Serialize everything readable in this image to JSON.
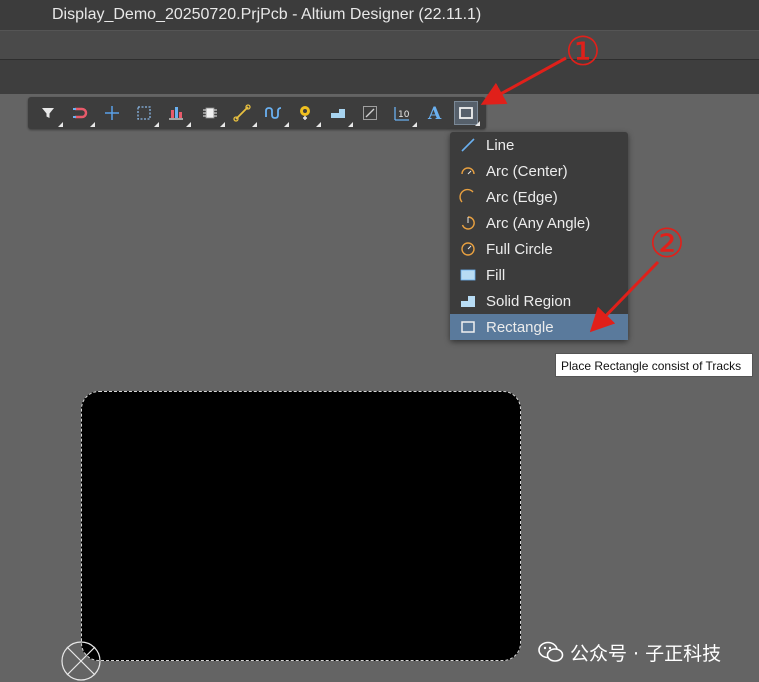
{
  "window": {
    "title": "Display_Demo_20250720.PrjPcb - Altium Designer (22.11.1)"
  },
  "toolbar": {
    "buttons": [
      {
        "name": "filter-icon"
      },
      {
        "name": "interactive-routing-magnet-icon"
      },
      {
        "name": "cross-select-icon"
      },
      {
        "name": "select-area-icon"
      },
      {
        "name": "align-icon"
      },
      {
        "name": "component-icon"
      },
      {
        "name": "interactive-routing-icon"
      },
      {
        "name": "length-tuning-icon"
      },
      {
        "name": "via-pad-icon"
      },
      {
        "name": "polygon-pour-icon"
      },
      {
        "name": "dimension-icon"
      },
      {
        "name": "string-coordinate-icon"
      },
      {
        "name": "text-string-icon"
      },
      {
        "name": "rectangle-tool-icon"
      }
    ]
  },
  "menu": {
    "items": [
      {
        "label": "Line",
        "icon": "line-icon"
      },
      {
        "label": "Arc (Center)",
        "icon": "arc-center-icon"
      },
      {
        "label": "Arc (Edge)",
        "icon": "arc-edge-icon"
      },
      {
        "label": "Arc (Any Angle)",
        "icon": "arc-any-angle-icon"
      },
      {
        "label": "Full Circle",
        "icon": "full-circle-icon"
      },
      {
        "label": "Fill",
        "icon": "fill-icon"
      },
      {
        "label": "Solid Region",
        "icon": "solid-region-icon"
      },
      {
        "label": "Rectangle",
        "icon": "rectangle-icon",
        "selected": true
      }
    ]
  },
  "tooltip": {
    "text": "Place Rectangle consist of Tracks"
  },
  "annotations": {
    "marker_1": "①",
    "marker_2": "②",
    "color": "#e0201a"
  },
  "watermark": {
    "text": "公众号 · 子正科技"
  },
  "colors": {
    "canvas": "#646464",
    "board": "#000000",
    "menu_selected": "#5a7a9c",
    "title_bar": "#3c3c3c"
  }
}
